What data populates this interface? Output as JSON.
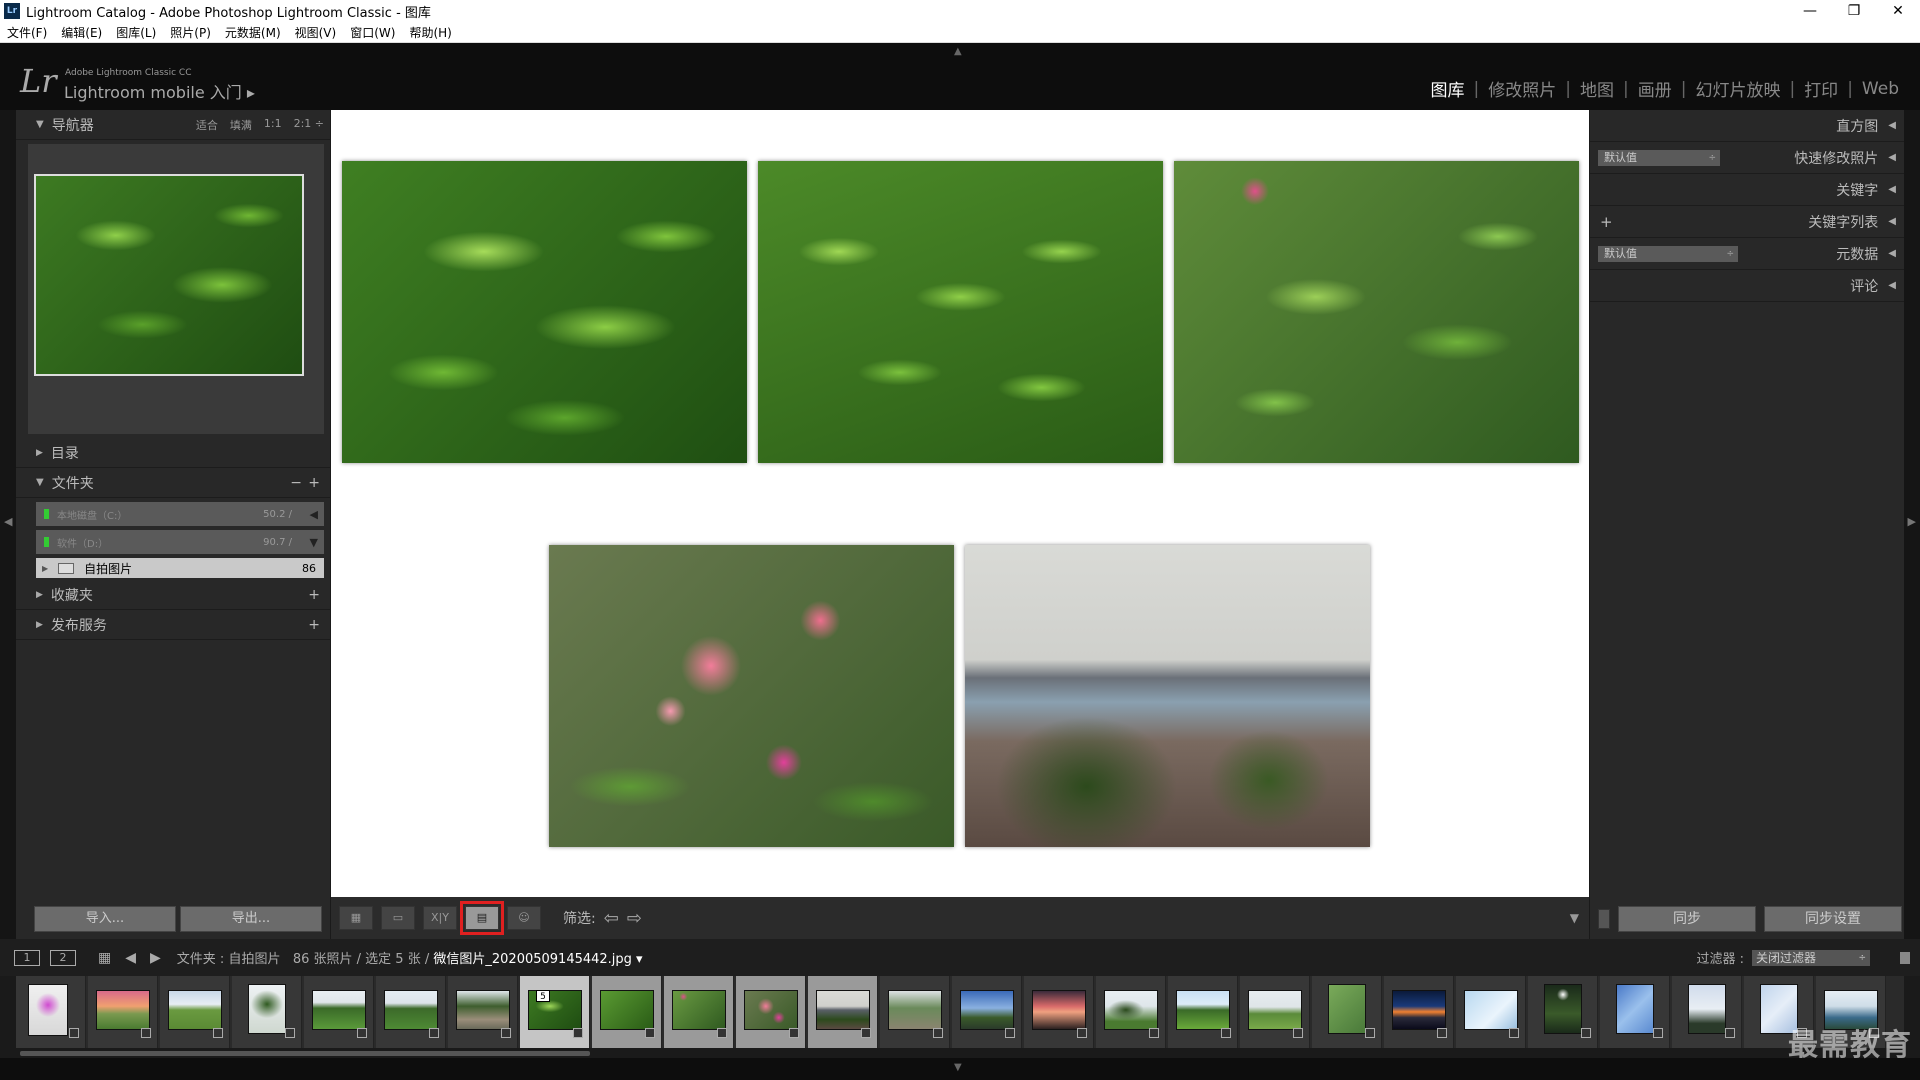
{
  "window": {
    "icon": "Lr",
    "title": "Lightroom Catalog - Adobe Photoshop Lightroom Classic - 图库",
    "controls": [
      "—",
      "❐",
      "✕"
    ]
  },
  "menu": [
    "文件(F)",
    "编辑(E)",
    "图库(L)",
    "照片(P)",
    "元数据(M)",
    "视图(V)",
    "窗口(W)",
    "帮助(H)"
  ],
  "identity": {
    "logo": "Lr",
    "small": "Adobe Lightroom Classic CC",
    "big": "Lightroom mobile 入门 ▸"
  },
  "modules": [
    {
      "label": "图库",
      "active": true
    },
    {
      "label": "修改照片"
    },
    {
      "label": "地图"
    },
    {
      "label": "画册"
    },
    {
      "label": "幻灯片放映"
    },
    {
      "label": "打印"
    },
    {
      "label": "Web"
    }
  ],
  "left": {
    "navigator": {
      "title": "导航器",
      "opts": [
        "适合",
        "填满",
        "1:1",
        "2:1 ÷"
      ]
    },
    "catalog": "目录",
    "folders": {
      "title": "文件夹",
      "volumes": [
        {
          "name": "本地磁盘（C:）",
          "size": "50.2 / "
        },
        {
          "name": "软件（D:）",
          "size": "90.7 / "
        }
      ],
      "folder": {
        "name": "自拍图片",
        "count": "86"
      }
    },
    "collections": "收藏夹",
    "publish": "发布服务",
    "import_btn": "导入...",
    "export_btn": "导出..."
  },
  "toolbar": {
    "grid": "▦",
    "loupe": "▭",
    "compare": "X|Y",
    "survey": "▤",
    "people": "☺",
    "filter_label": "筛选:",
    "prev": "⇦",
    "next": "⇨",
    "dd": "▼"
  },
  "right": {
    "histogram": "直方图",
    "quick_develop": "快速修改照片",
    "preset_default": "默认值",
    "keywording": "关键字",
    "keyword_list": "关键字列表",
    "metadata": "元数据",
    "metadata_default": "默认值",
    "comments": "评论",
    "sync": "同步",
    "sync_settings": "同步设置"
  },
  "filmstrip_bar": {
    "page1": "1",
    "page2": "2",
    "path_prefix": "文件夹 : 自拍图片",
    "count": "86 张照片 / 选定 5 张 /",
    "filename": "微信图片_20200509145442.jpg ▾",
    "filter_label": "过滤器 :",
    "filter_value": "关闭过滤器"
  },
  "selected_badge": "5",
  "watermark": "最需教育",
  "colors": {
    "accent_red": "#e02020",
    "panel": "#282828",
    "survey_bg": "#ffffff"
  }
}
